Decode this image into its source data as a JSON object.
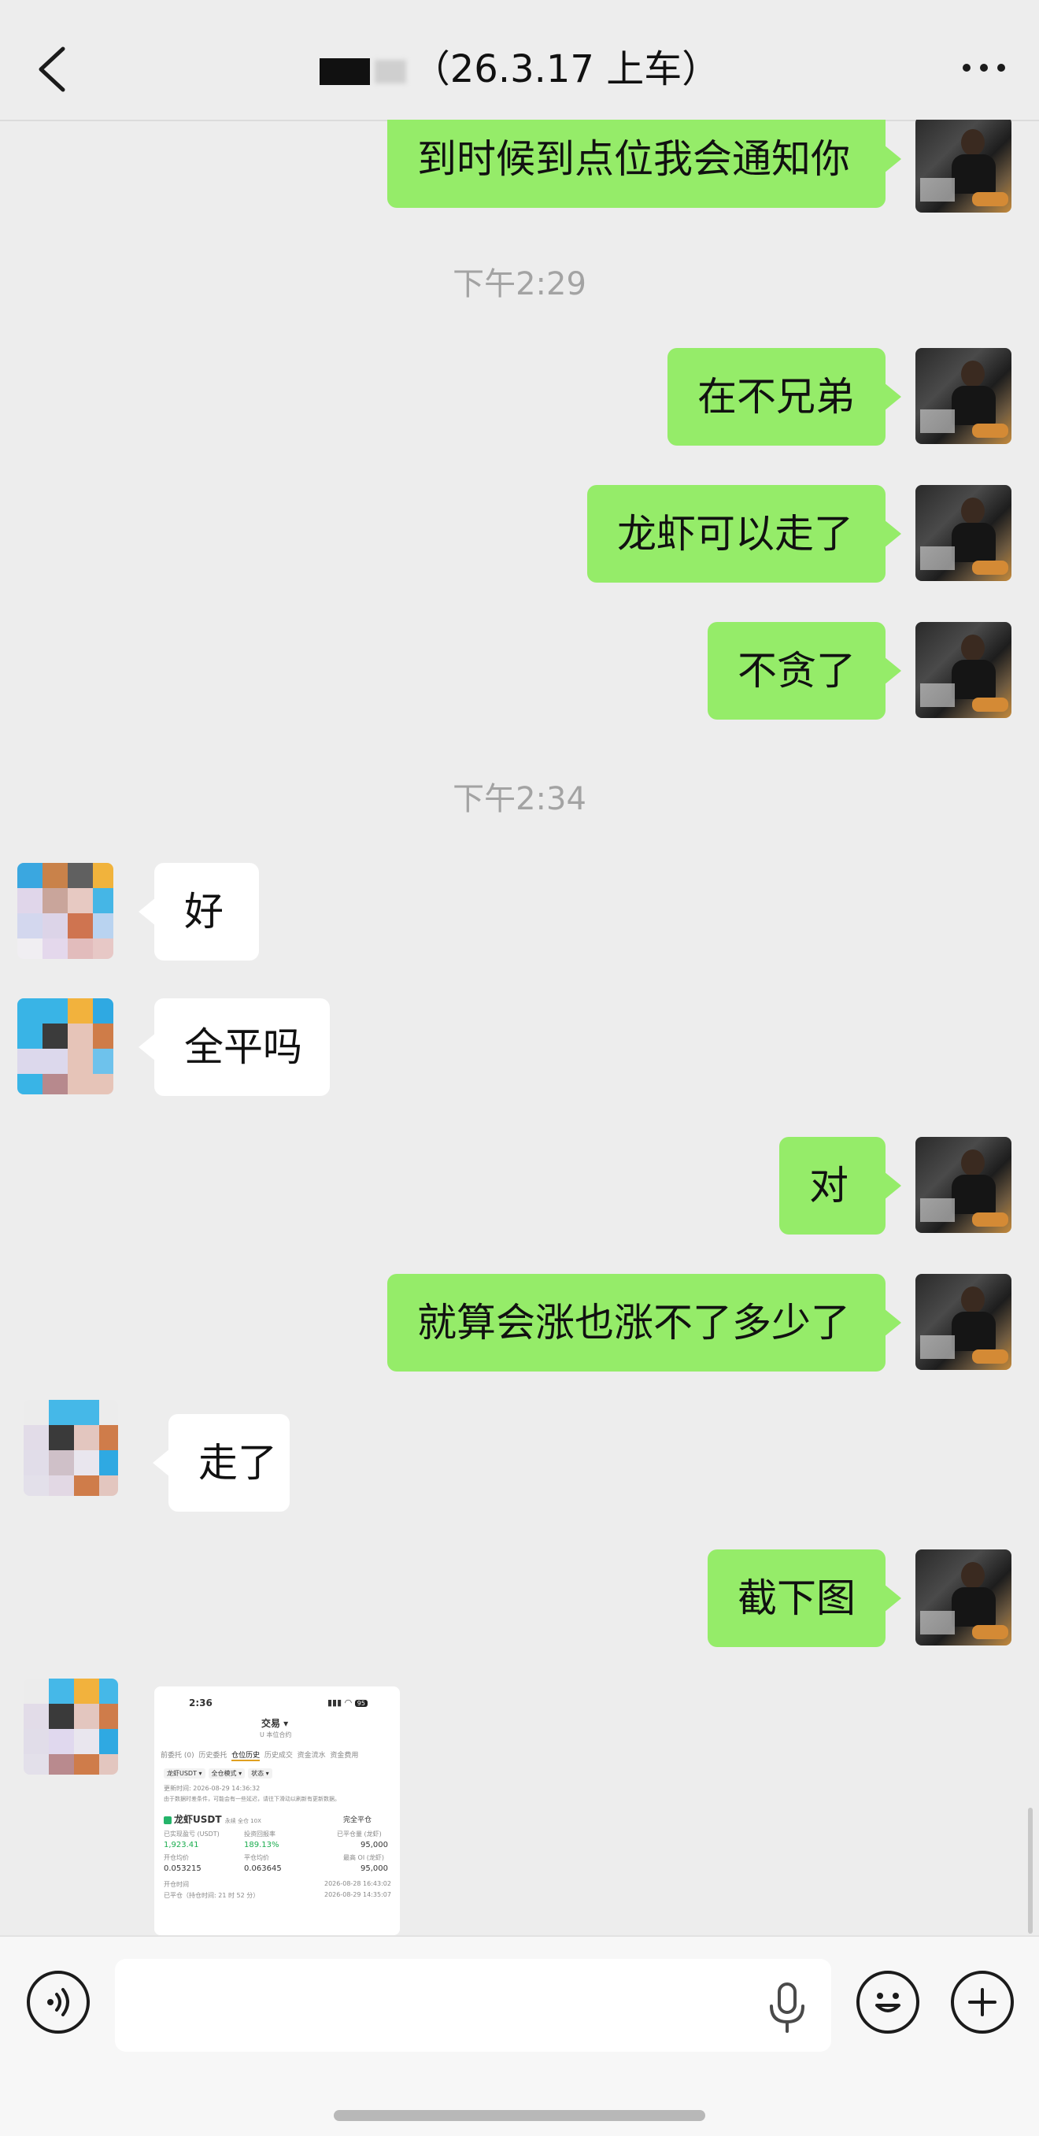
{
  "header": {
    "title": "（26.3.17 上车）"
  },
  "messages": [
    {
      "type": "text",
      "side": "out",
      "text": "到时候到点位我会通知你"
    },
    {
      "type": "time",
      "text": "下午2:29"
    },
    {
      "type": "text",
      "side": "out",
      "text": "在不兄弟"
    },
    {
      "type": "text",
      "side": "out",
      "text": "龙虾可以走了"
    },
    {
      "type": "text",
      "side": "out",
      "text": "不贪了"
    },
    {
      "type": "time",
      "text": "下午2:34"
    },
    {
      "type": "text",
      "side": "in",
      "text": "好"
    },
    {
      "type": "text",
      "side": "in",
      "text": "全平吗"
    },
    {
      "type": "text",
      "side": "out",
      "text": "对"
    },
    {
      "type": "text",
      "side": "out",
      "text": "就算会涨也涨不了多少了"
    },
    {
      "type": "text",
      "side": "in",
      "text": "走了"
    },
    {
      "type": "text",
      "side": "out",
      "text": "截下图"
    },
    {
      "type": "image",
      "side": "in"
    }
  ],
  "screenshot": {
    "status_time": "2:36",
    "battery": "95",
    "title": "交易 ▾",
    "subtitle": "U 本位合约",
    "tabs": [
      "前委托 (0)",
      "历史委托",
      "仓位历史",
      "历史成交",
      "资金流水",
      "资金费用"
    ],
    "active_tab": "仓位历史",
    "filters": [
      "龙虾USDT ▾",
      "全仓模式 ▾",
      "状态 ▾"
    ],
    "updated": "更新时间: 2026-08-29 14:36:32",
    "notice": "由于数据时差条件，可能会有一些延迟，请往下滑动以刷新有更新数据。",
    "symbol": "龙虾USDT",
    "symbol_tags": "永续  全仓 10X",
    "status_label": "完全平仓",
    "realized_pnl_label": "已实现盈亏 (USDT)",
    "realized_pnl": "1,923.41",
    "roi_label": "投资回报率",
    "roi": "189.13%",
    "closed_qty_label": "已平仓量 (龙虾)",
    "closed_qty": "95,000",
    "entry_label": "开仓均价",
    "entry_price": "0.053215",
    "close_avg_label": "平仓均价",
    "close_price": "0.063645",
    "max_pos_label": "最高 OI (龙虾)",
    "max_pos": "95,000",
    "open_time_label": "开仓时间",
    "open_time": "2026-08-28 16:43:02",
    "close_time_label": "已平仓（持仓时间: 21 时 52 分）",
    "close_time": "2026-08-29 14:35:07"
  },
  "input": {
    "placeholder": ""
  },
  "colors": {
    "outgoing_bubble": "#95ec69",
    "incoming_bubble": "#ffffff",
    "background": "#ededed"
  }
}
